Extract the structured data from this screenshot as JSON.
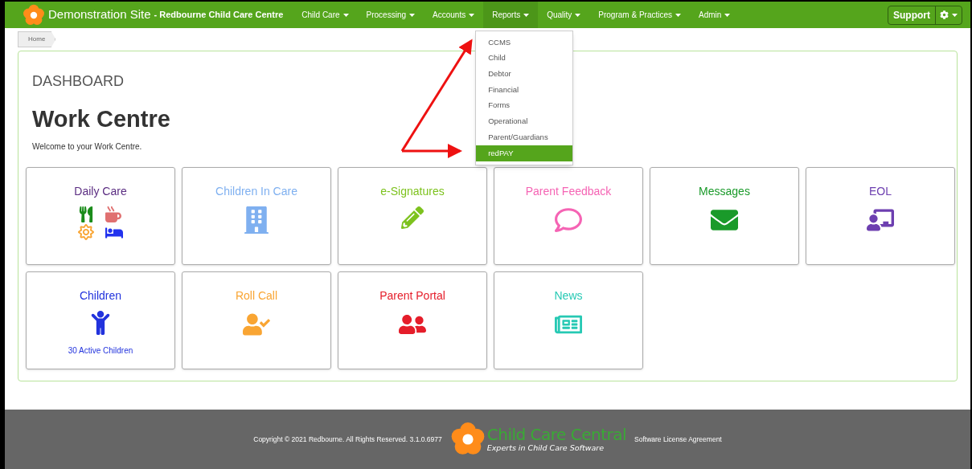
{
  "header": {
    "site": "Demonstration Site",
    "centre": "- Redbourne Child Care Centre",
    "nav": [
      {
        "label": "Child Care",
        "expanded": false
      },
      {
        "label": "Processing",
        "expanded": false
      },
      {
        "label": "Accounts",
        "expanded": false
      },
      {
        "label": "Reports",
        "expanded": true,
        "menu": [
          {
            "label": "CCMS",
            "selected": false
          },
          {
            "label": "Child",
            "selected": false
          },
          {
            "label": "Debtor",
            "selected": false
          },
          {
            "label": "Financial",
            "selected": false
          },
          {
            "label": "Forms",
            "selected": false
          },
          {
            "label": "Operational",
            "selected": false
          },
          {
            "label": "Parent/Guardians",
            "selected": false
          },
          {
            "label": "redPAY",
            "selected": true
          }
        ]
      },
      {
        "label": "Quality",
        "expanded": false
      },
      {
        "label": "Program & Practices",
        "expanded": false
      },
      {
        "label": "Admin",
        "expanded": false
      }
    ],
    "support": "Support"
  },
  "breadcrumb": [
    "Home"
  ],
  "dashboard": {
    "section": "DASHBOARD",
    "title": "Work Centre",
    "welcome": "Welcome to your Work Centre.",
    "tiles": [
      {
        "title": "Daily Care",
        "kind": "daily_care",
        "color": "#5b2d82"
      },
      {
        "title": "Children In Care",
        "kind": "building",
        "color": "#7fb0f0"
      },
      {
        "title": "e-Signatures",
        "kind": "pencil",
        "color": "#7dc21e"
      },
      {
        "title": "Parent Feedback",
        "kind": "feedback",
        "color": "#f564b4"
      },
      {
        "title": "Messages",
        "kind": "envelope",
        "color": "#1a9a2a"
      },
      {
        "title": "EOL",
        "kind": "teacher",
        "color": "#6d3fb0"
      },
      {
        "title": "Children",
        "kind": "child",
        "color": "#2233dd",
        "subtitle": "30 Active Children"
      },
      {
        "title": "Roll Call",
        "kind": "rollcall",
        "color": "#f9a533"
      },
      {
        "title": "Parent Portal",
        "kind": "portal",
        "color": "#e51d2a"
      },
      {
        "title": "News",
        "kind": "news",
        "color": "#27c9b4"
      }
    ]
  },
  "footer": {
    "copyright": "Copyright © 2021 Redbourne. All Rights Reserved. 3.1.0.6977",
    "logo_name": "Child Care Central",
    "logo_tagline": "Experts in Child Care Software",
    "license": "Software License Agreement"
  }
}
